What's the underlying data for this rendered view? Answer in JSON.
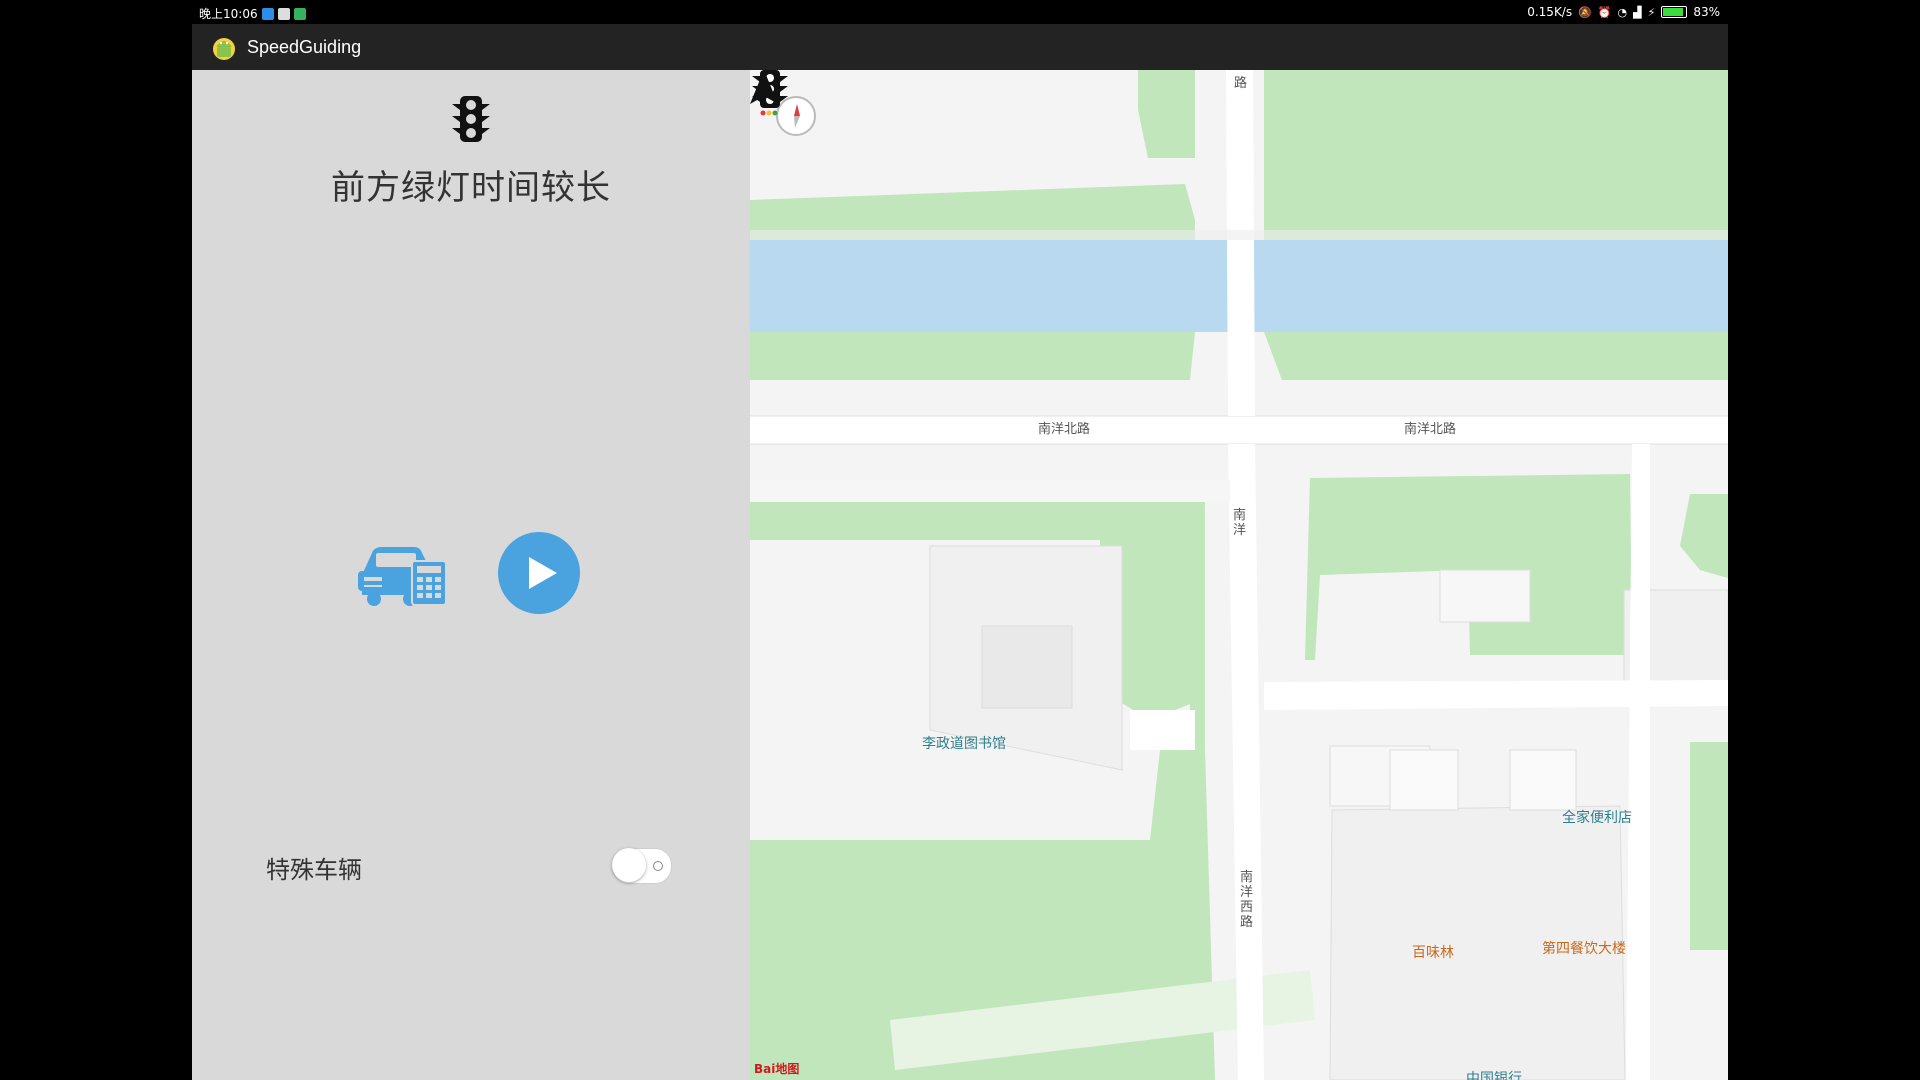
{
  "status_bar": {
    "time": "晚上10:06",
    "net_speed": "0.15K/s",
    "battery_percent": "83%"
  },
  "app": {
    "title": "SpeedGuiding",
    "icon": "android-icon"
  },
  "panel": {
    "traffic_icon": "traffic-light-icon",
    "status_message": "前方绿灯时间较长",
    "car_button_icon": "car-calculator-icon",
    "play_button_icon": "play-icon",
    "special_vehicle_label": "特殊车辆",
    "special_vehicle_enabled": false
  },
  "map": {
    "roads": {
      "north_road_top": "路",
      "nanyang_north_left": "南洋北路",
      "nanyang_north_right": "南洋北路",
      "nanyang_vertical": "南洋",
      "nanyang_west": "南洋西路"
    },
    "pois": [
      {
        "name": "李政道图书馆"
      },
      {
        "name": "全家便利店"
      },
      {
        "name": "百味林"
      },
      {
        "name": "第四餐饮大楼"
      },
      {
        "name": "中国银行"
      }
    ],
    "attribution": "Bai地图",
    "colors": {
      "green": "#c1e6bc",
      "water": "#b9d9f1",
      "road": "#ffffff",
      "ground": "#f4f4f4",
      "accent": "#4aa3df"
    }
  }
}
